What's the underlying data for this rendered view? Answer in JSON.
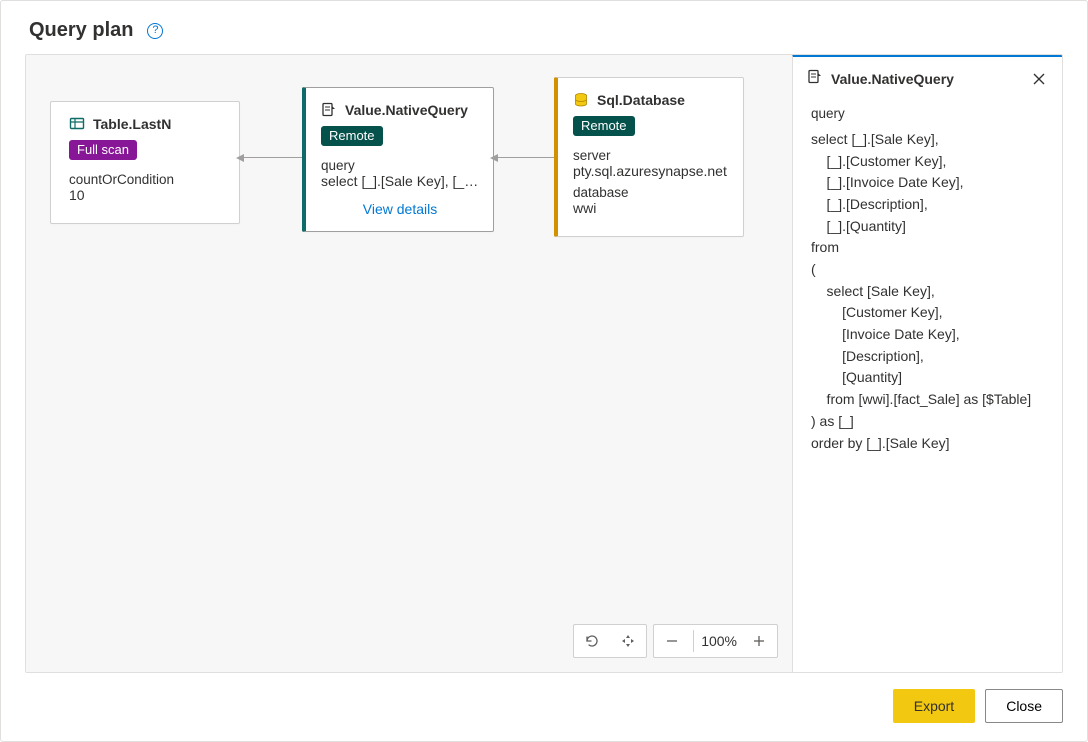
{
  "header": {
    "title": "Query plan",
    "help_tooltip": "?"
  },
  "nodes": {
    "tableLastN": {
      "title": "Table.LastN",
      "badge": "Full scan",
      "param_label": "countOrCondition",
      "param_value": "10"
    },
    "nativeQuery": {
      "title": "Value.NativeQuery",
      "badge": "Remote",
      "param_label": "query",
      "param_value": "select [_].[Sale Key], [_]....",
      "view_details": "View details"
    },
    "sqlDatabase": {
      "title": "Sql.Database",
      "badge": "Remote",
      "server_label": "server",
      "server_value": "pty.sql.azuresynapse.net",
      "database_label": "database",
      "database_value": "wwi"
    }
  },
  "zoom": {
    "percent": "100%"
  },
  "details": {
    "title": "Value.NativeQuery",
    "label": "query",
    "query": "select [_].[Sale Key],\n    [_].[Customer Key],\n    [_].[Invoice Date Key],\n    [_].[Description],\n    [_].[Quantity]\nfrom\n(\n    select [Sale Key],\n        [Customer Key],\n        [Invoice Date Key],\n        [Description],\n        [Quantity]\n    from [wwi].[fact_Sale] as [$Table]\n) as [_]\norder by [_].[Sale Key]"
  },
  "footer": {
    "export": "Export",
    "close": "Close"
  }
}
